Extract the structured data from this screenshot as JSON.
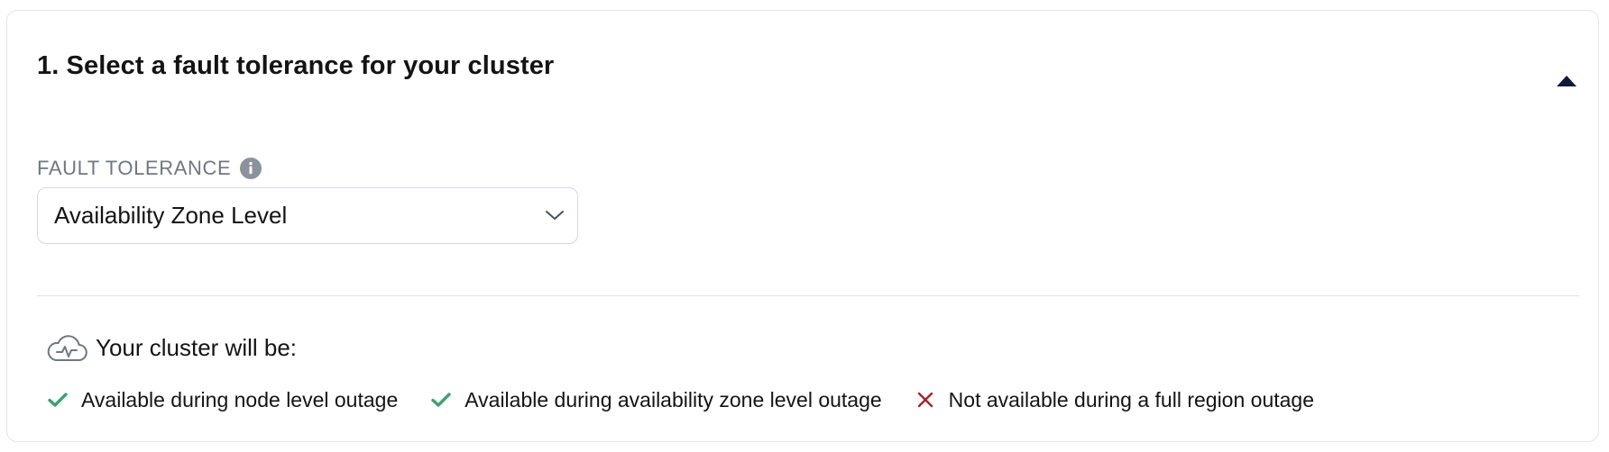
{
  "section": {
    "title": "1. Select a fault tolerance for your cluster",
    "collapse_icon": "caret-up-icon"
  },
  "fault_tolerance": {
    "label": "FAULT TOLERANCE",
    "info_icon": "info-icon",
    "selected_value": "Availability Zone Level",
    "dropdown_icon": "chevron-down-icon"
  },
  "summary": {
    "icon": "cloud-heartbeat-icon",
    "heading": "Your cluster will be:",
    "items": [
      {
        "text": "Available during node level outage",
        "status": "available",
        "icon": "check-icon",
        "color": "#3fa26b"
      },
      {
        "text": "Available during availability zone level outage",
        "status": "available",
        "icon": "check-icon",
        "color": "#3fa26b"
      },
      {
        "text": "Not available during a full region outage",
        "status": "unavailable",
        "icon": "x-icon",
        "color": "#a3242e"
      }
    ]
  },
  "colors": {
    "text": "#141414",
    "muted_label": "#6e7783",
    "border": "#d5d9de",
    "caret": "#0e1a3b",
    "success": "#3fa26b",
    "danger": "#a3242e"
  }
}
